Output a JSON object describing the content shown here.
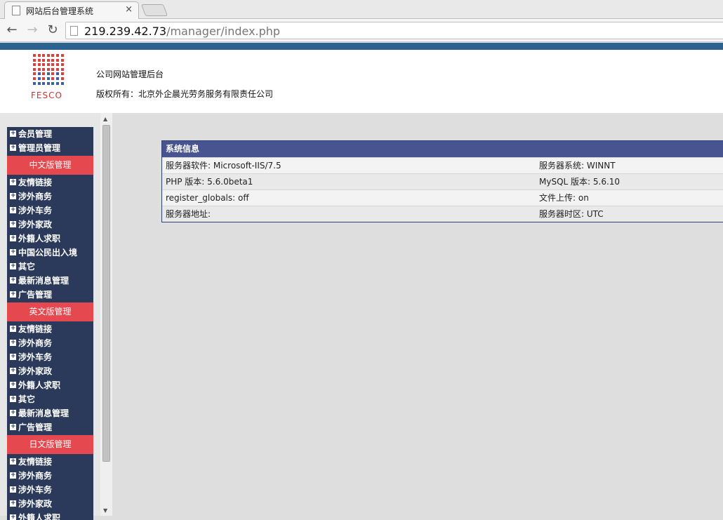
{
  "browser": {
    "tab_title": "网站后台管理系统",
    "tab_close": "×",
    "url_host": "219.239.42.73",
    "url_path": "/manager/index.php",
    "back_icon": "←",
    "forward_icon": "→",
    "reload_icon": "↻"
  },
  "header": {
    "logo_text": "FESCO",
    "site_title": "公司网站管理后台",
    "copyright": "版权所有：北京外企晨光劳务服务有限责任公司",
    "colors": {
      "topbar": "#2d6190",
      "logo_red": "#d8413e",
      "logo_blue": "#3a5fa8"
    }
  },
  "sidebar": {
    "top_items": [
      "会员管理",
      "管理员管理"
    ],
    "sections": [
      {
        "title": "中文版管理",
        "items": [
          "友情链接",
          "涉外商务",
          "涉外车务",
          "涉外家政",
          "外籍人求职",
          "中国公民出入境",
          "其它",
          "最新消息管理",
          "广告管理"
        ]
      },
      {
        "title": "英文版管理",
        "items": [
          "友情链接",
          "涉外商务",
          "涉外车务",
          "涉外家政",
          "外籍人求职",
          "其它",
          "最新消息管理",
          "广告管理"
        ]
      },
      {
        "title": "日文版管理",
        "items": [
          "友情链接",
          "涉外商务",
          "涉外车务",
          "涉外家政",
          "外籍人求职"
        ]
      }
    ],
    "colors": {
      "background": "#2b3a5a",
      "section": "#e5484e"
    }
  },
  "system_info": {
    "title": "系统信息",
    "rows": [
      {
        "left": "服务器软件: Microsoft-IIS/7.5",
        "right": "服务器系统: WINNT"
      },
      {
        "left": "PHP 版本: 5.6.0beta1",
        "right": "MySQL 版本: 5.6.10"
      },
      {
        "left": "register_globals: off",
        "right": "文件上传: on"
      },
      {
        "left": "服务器地址:",
        "right": "服务器时区: UTC"
      }
    ],
    "colors": {
      "header": "#48548f"
    }
  }
}
